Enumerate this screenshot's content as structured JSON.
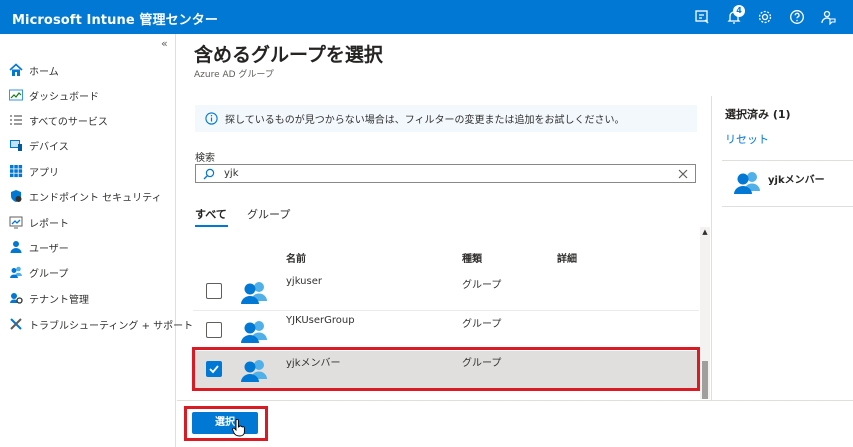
{
  "header": {
    "brand": "Microsoft Intune 管理センター",
    "notification_count": "4",
    "icons": [
      "feedback-icon",
      "bell-icon",
      "gear-icon",
      "help-icon",
      "person-feedback-icon"
    ]
  },
  "sidebar": {
    "collapse_glyph": "«",
    "items": [
      {
        "label": "ホーム",
        "icon": "home-icon"
      },
      {
        "label": "ダッシュボード",
        "icon": "dashboard-icon"
      },
      {
        "label": "すべてのサービス",
        "icon": "list-icon"
      },
      {
        "label": "デバイス",
        "icon": "devices-icon"
      },
      {
        "label": "アプリ",
        "icon": "apps-icon"
      },
      {
        "label": "エンドポイント セキュリティ",
        "icon": "shield-icon"
      },
      {
        "label": "レポート",
        "icon": "report-icon"
      },
      {
        "label": "ユーザー",
        "icon": "user-icon"
      },
      {
        "label": "グループ",
        "icon": "group-icon"
      },
      {
        "label": "テナント管理",
        "icon": "tenant-admin-icon"
      },
      {
        "label": "トラブルシューティング + サポート",
        "icon": "troubleshoot-icon"
      }
    ]
  },
  "panel": {
    "title": "含めるグループを選択",
    "subtitle": "Azure AD グループ",
    "info": "探しているものが見つからない場合は、フィルターの変更または追加をお試しください。",
    "search_label": "検索",
    "search_value": "yjk",
    "tabs": [
      "すべて",
      "グループ"
    ],
    "columns": [
      "名前",
      "種類",
      "詳細"
    ],
    "rows": [
      {
        "name": "yjkuser",
        "type": "グループ",
        "checked": false
      },
      {
        "name": "YJKUserGroup",
        "type": "グループ",
        "checked": false
      },
      {
        "name": "yjkメンバー",
        "type": "グループ",
        "checked": true
      }
    ],
    "select_button": "選択"
  },
  "selected_panel": {
    "title": "選択済み (1)",
    "reset": "リセット",
    "items": [
      {
        "name": "yjkメンバー"
      }
    ]
  },
  "colors": {
    "accent": "#0078d4",
    "highlight": "#d91c24"
  }
}
